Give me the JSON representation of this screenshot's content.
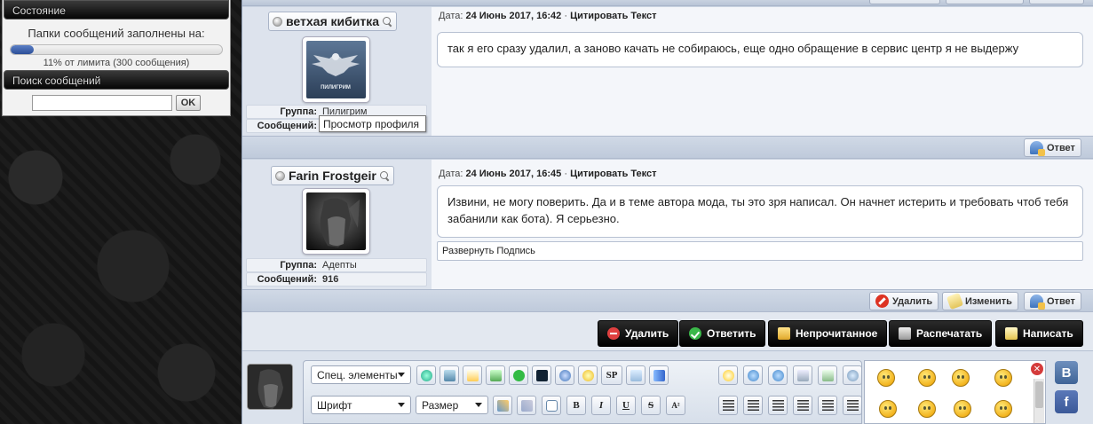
{
  "sidebar": {
    "status_title": "Состояние",
    "quota_label": "Папки сообщений заполнены на:",
    "quota_percent": 11,
    "quota_sub": "11% от лимита (300 сообщения)",
    "search_title": "Поиск сообщений",
    "search_value": "",
    "ok_label": "OK"
  },
  "posts": [
    {
      "author": "ветхая кибитка",
      "date_label": "Дата:",
      "date": "24 Июнь 2017, 16:42",
      "quote_label": "Цитировать Текст",
      "message": "так я его сразу удалил, а заново качать не собираюсь, еще одно обращение в сервис центр я не выдержу",
      "group_label": "Группа:",
      "group": "Пилигрим",
      "messages_label": "Сообщений:",
      "messages_count": "",
      "avatar_caption": "ПИЛИГРИМ",
      "reply_label": "Ответ"
    },
    {
      "author": "Farin Frostgeir",
      "date_label": "Дата:",
      "date": "24 Июнь 2017, 16:45",
      "quote_label": "Цитировать Текст",
      "message": "Извини, не могу поверить. Да и в теме автора мода, ты это зря написал. Он начнет истерить и требовать чтоб тебя забанили как бота). Я серьезно.",
      "signature_label": "Развернуть Подпись",
      "group_label": "Группа:",
      "group": "Адепты",
      "messages_label": "Сообщений:",
      "messages_count": "916",
      "delete_label": "Удалить",
      "edit_label": "Изменить",
      "reply_label": "Ответ"
    }
  ],
  "tooltip": "Просмотр профиля",
  "action_bar": {
    "delete": "Удалить",
    "reply": "Ответить",
    "unread": "Непрочитанное",
    "print": "Распечатать",
    "write": "Написать"
  },
  "editor": {
    "special_select": "Спец. элементы",
    "font_select": "Шрифт",
    "size_select": "Размер",
    "btn_sp": "SP",
    "btn_bold": "B",
    "btn_italic": "I",
    "btn_underline": "U",
    "btn_strike": "S",
    "btn_sup": "A²",
    "close_symbol": "✕",
    "social_vk": "B",
    "social_fb": "f"
  },
  "icons": {
    "post_reply": "reply-icon",
    "post_delete": "delete-icon",
    "post_edit": "edit-icon"
  }
}
